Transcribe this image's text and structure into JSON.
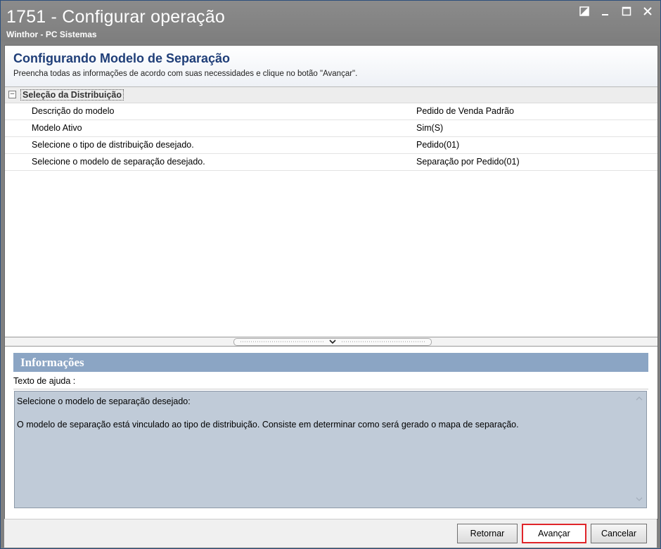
{
  "window": {
    "title": "1751 - Configurar operação",
    "subtitle": "Winthor - PC Sistemas"
  },
  "header": {
    "title": "Configurando Modelo de Separação",
    "description": "Preencha todas as informações de acordo com suas necessidades e clique no botão \"Avançar\"."
  },
  "grid": {
    "category": "Seleção da Distribuição",
    "rows": [
      {
        "name": "Descrição do modelo",
        "value": "Pedido de Venda Padrão"
      },
      {
        "name": "Modelo Ativo",
        "value": "Sim(S)"
      },
      {
        "name": "Selecione o tipo de distribuição desejado.",
        "value": "Pedido(01)"
      },
      {
        "name": "Selecione o modelo de separação desejado.",
        "value": "Separação por Pedido(01)"
      }
    ]
  },
  "info": {
    "title": "Informações",
    "help_label": "Texto de ajuda :",
    "help_line1": "Selecione o modelo de separação desejado:",
    "help_line2": "O modelo de separação está vinculado ao tipo de distribuição. Consiste em determinar como será gerado o mapa de separação."
  },
  "buttons": {
    "back": "Retornar",
    "next": "Avançar",
    "cancel": "Cancelar"
  },
  "icons": {
    "restore": "restore-icon",
    "minimize": "minimize-icon",
    "maximize": "maximize-icon",
    "close": "close-icon"
  },
  "colors": {
    "titlebar": "#808080",
    "header_title": "#1f3e78",
    "info_header": "#8ba5c4",
    "help_box": "#c0cbd8",
    "primary_border": "#e0252a"
  }
}
